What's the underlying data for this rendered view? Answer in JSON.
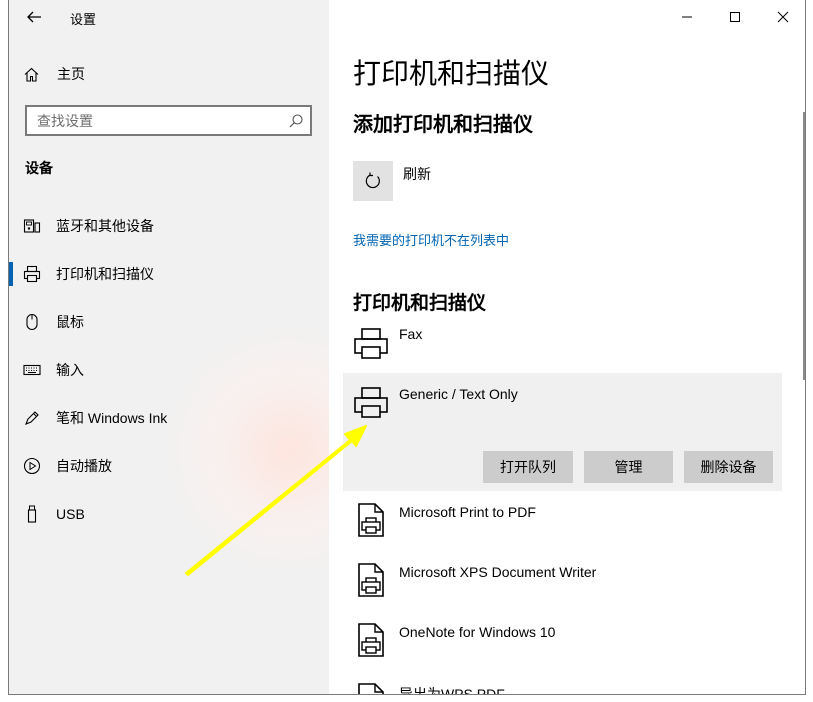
{
  "window": {
    "app_title": "设置",
    "back_icon": "back-arrow-icon",
    "minimize_icon": "minimize-icon",
    "maximize_icon": "maximize-icon",
    "close_icon": "close-icon"
  },
  "sidebar": {
    "home_label": "主页",
    "search": {
      "placeholder": "查找设置",
      "value": ""
    },
    "section_label": "设备",
    "items": [
      {
        "label": "蓝牙和其他设备",
        "icon": "bluetooth-devices-icon",
        "selected": false
      },
      {
        "label": "打印机和扫描仪",
        "icon": "printer-icon",
        "selected": true
      },
      {
        "label": "鼠标",
        "icon": "mouse-icon",
        "selected": false
      },
      {
        "label": "输入",
        "icon": "keyboard-icon",
        "selected": false
      },
      {
        "label": "笔和 Windows Ink",
        "icon": "pen-icon",
        "selected": false
      },
      {
        "label": "自动播放",
        "icon": "autoplay-icon",
        "selected": false
      },
      {
        "label": "USB",
        "icon": "usb-icon",
        "selected": false
      }
    ]
  },
  "main": {
    "page_title": "打印机和扫描仪",
    "add_section_title": "添加打印机和扫描仪",
    "refresh_label": "刷新",
    "not_listed_link": "我需要的打印机不在列表中",
    "list_title": "打印机和扫描仪",
    "devices": [
      {
        "name": "Fax",
        "icon": "printer-icon"
      },
      {
        "name": "Generic / Text Only",
        "icon": "printer-icon",
        "expanded": true,
        "actions": [
          "打开队列",
          "管理",
          "删除设备"
        ]
      },
      {
        "name": "Microsoft Print to PDF",
        "icon": "document-printer-icon"
      },
      {
        "name": "Microsoft XPS Document Writer",
        "icon": "document-printer-icon"
      },
      {
        "name": "OneNote for Windows 10",
        "icon": "document-printer-icon"
      },
      {
        "name": "导出为WPS PDF",
        "icon": "document-printer-icon"
      }
    ]
  },
  "annotation": {
    "color": "#ffff00"
  },
  "colors": {
    "accent": "#0063b1",
    "sidebar_bg": "#f1f1f1",
    "button_bg": "#cccccc",
    "expanded_bg": "#f0f0f0"
  }
}
